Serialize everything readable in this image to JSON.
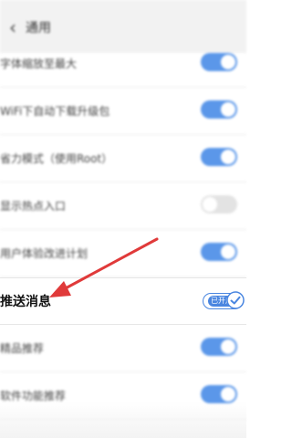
{
  "header": {
    "title": "通用",
    "back_icon": "‹"
  },
  "settings": [
    {
      "label": "字体缩放至最大",
      "state": "on"
    },
    {
      "label": "WiFi下自动下载升级包",
      "state": "on"
    },
    {
      "label": "省力模式（使用Root）",
      "state": "on"
    },
    {
      "label": "显示热点入口",
      "state": "off"
    },
    {
      "label": "用户体验改进计划",
      "state": "on"
    }
  ],
  "focus": {
    "label": "推送消息",
    "badge": "已开启"
  },
  "settings_below": [
    {
      "label": "精品推荐",
      "state": "on"
    },
    {
      "label": "软件功能推荐",
      "state": "on"
    }
  ],
  "colors": {
    "accent": "#4a86e0",
    "arrow": "#e03a3a"
  }
}
